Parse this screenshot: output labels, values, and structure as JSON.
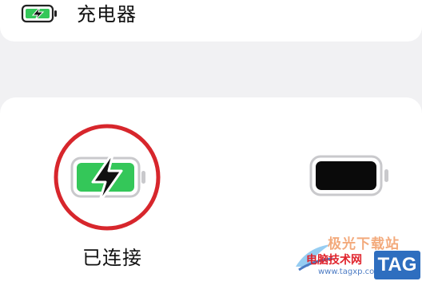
{
  "colors": {
    "background": "#f1f1f3",
    "card": "#ffffff",
    "battery_fill": "#34c759",
    "highlight_circle": "#d7262c"
  },
  "charger_row": {
    "icon": "charging-battery-icon",
    "label": "充电器"
  },
  "connected_device": {
    "icon": "charging-battery-icon",
    "status": "已连接"
  },
  "other_device": {
    "icon": "battery-icon"
  },
  "watermark": {
    "site": "极光下载站",
    "name": "电脑技术网",
    "url": "www.tagxp.com",
    "tag": "TAG"
  }
}
